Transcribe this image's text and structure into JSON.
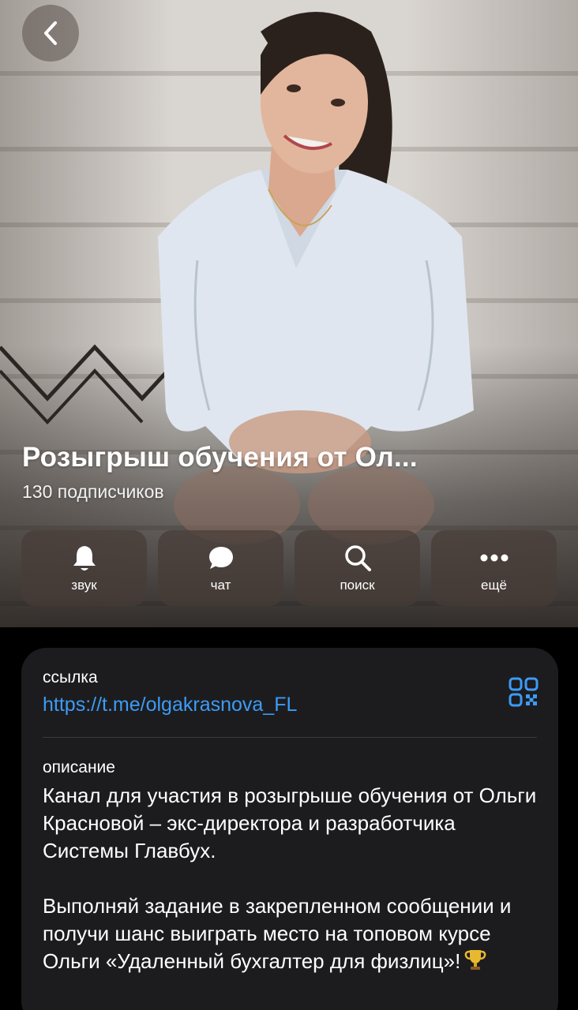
{
  "header": {
    "channel_title": "Розыгрыш обучения от Ол...",
    "subscribers": "130 подписчиков"
  },
  "actions": [
    {
      "label": "звук",
      "icon": "bell-icon"
    },
    {
      "label": "чат",
      "icon": "chat-bubble-icon"
    },
    {
      "label": "поиск",
      "icon": "search-icon"
    },
    {
      "label": "ещё",
      "icon": "more-dots-icon"
    }
  ],
  "info": {
    "link_label": "ссылка",
    "link_value": "https://t.me/olgakrasnova_FL",
    "description_label": "описание",
    "description_p1": "Канал для участия в розыгрыше обучения от Ольги Красновой – экс-директора и разработчика Системы Главбух.",
    "description_p2": "Выполняй задание в закрепленном сообщении и получи шанс выиграть место на топовом курсе Ольги «Удаленный бухгалтер для физлиц»!"
  },
  "colors": {
    "link": "#3d9bf5",
    "card_bg": "#1c1c1e",
    "page_bg": "#000000"
  }
}
